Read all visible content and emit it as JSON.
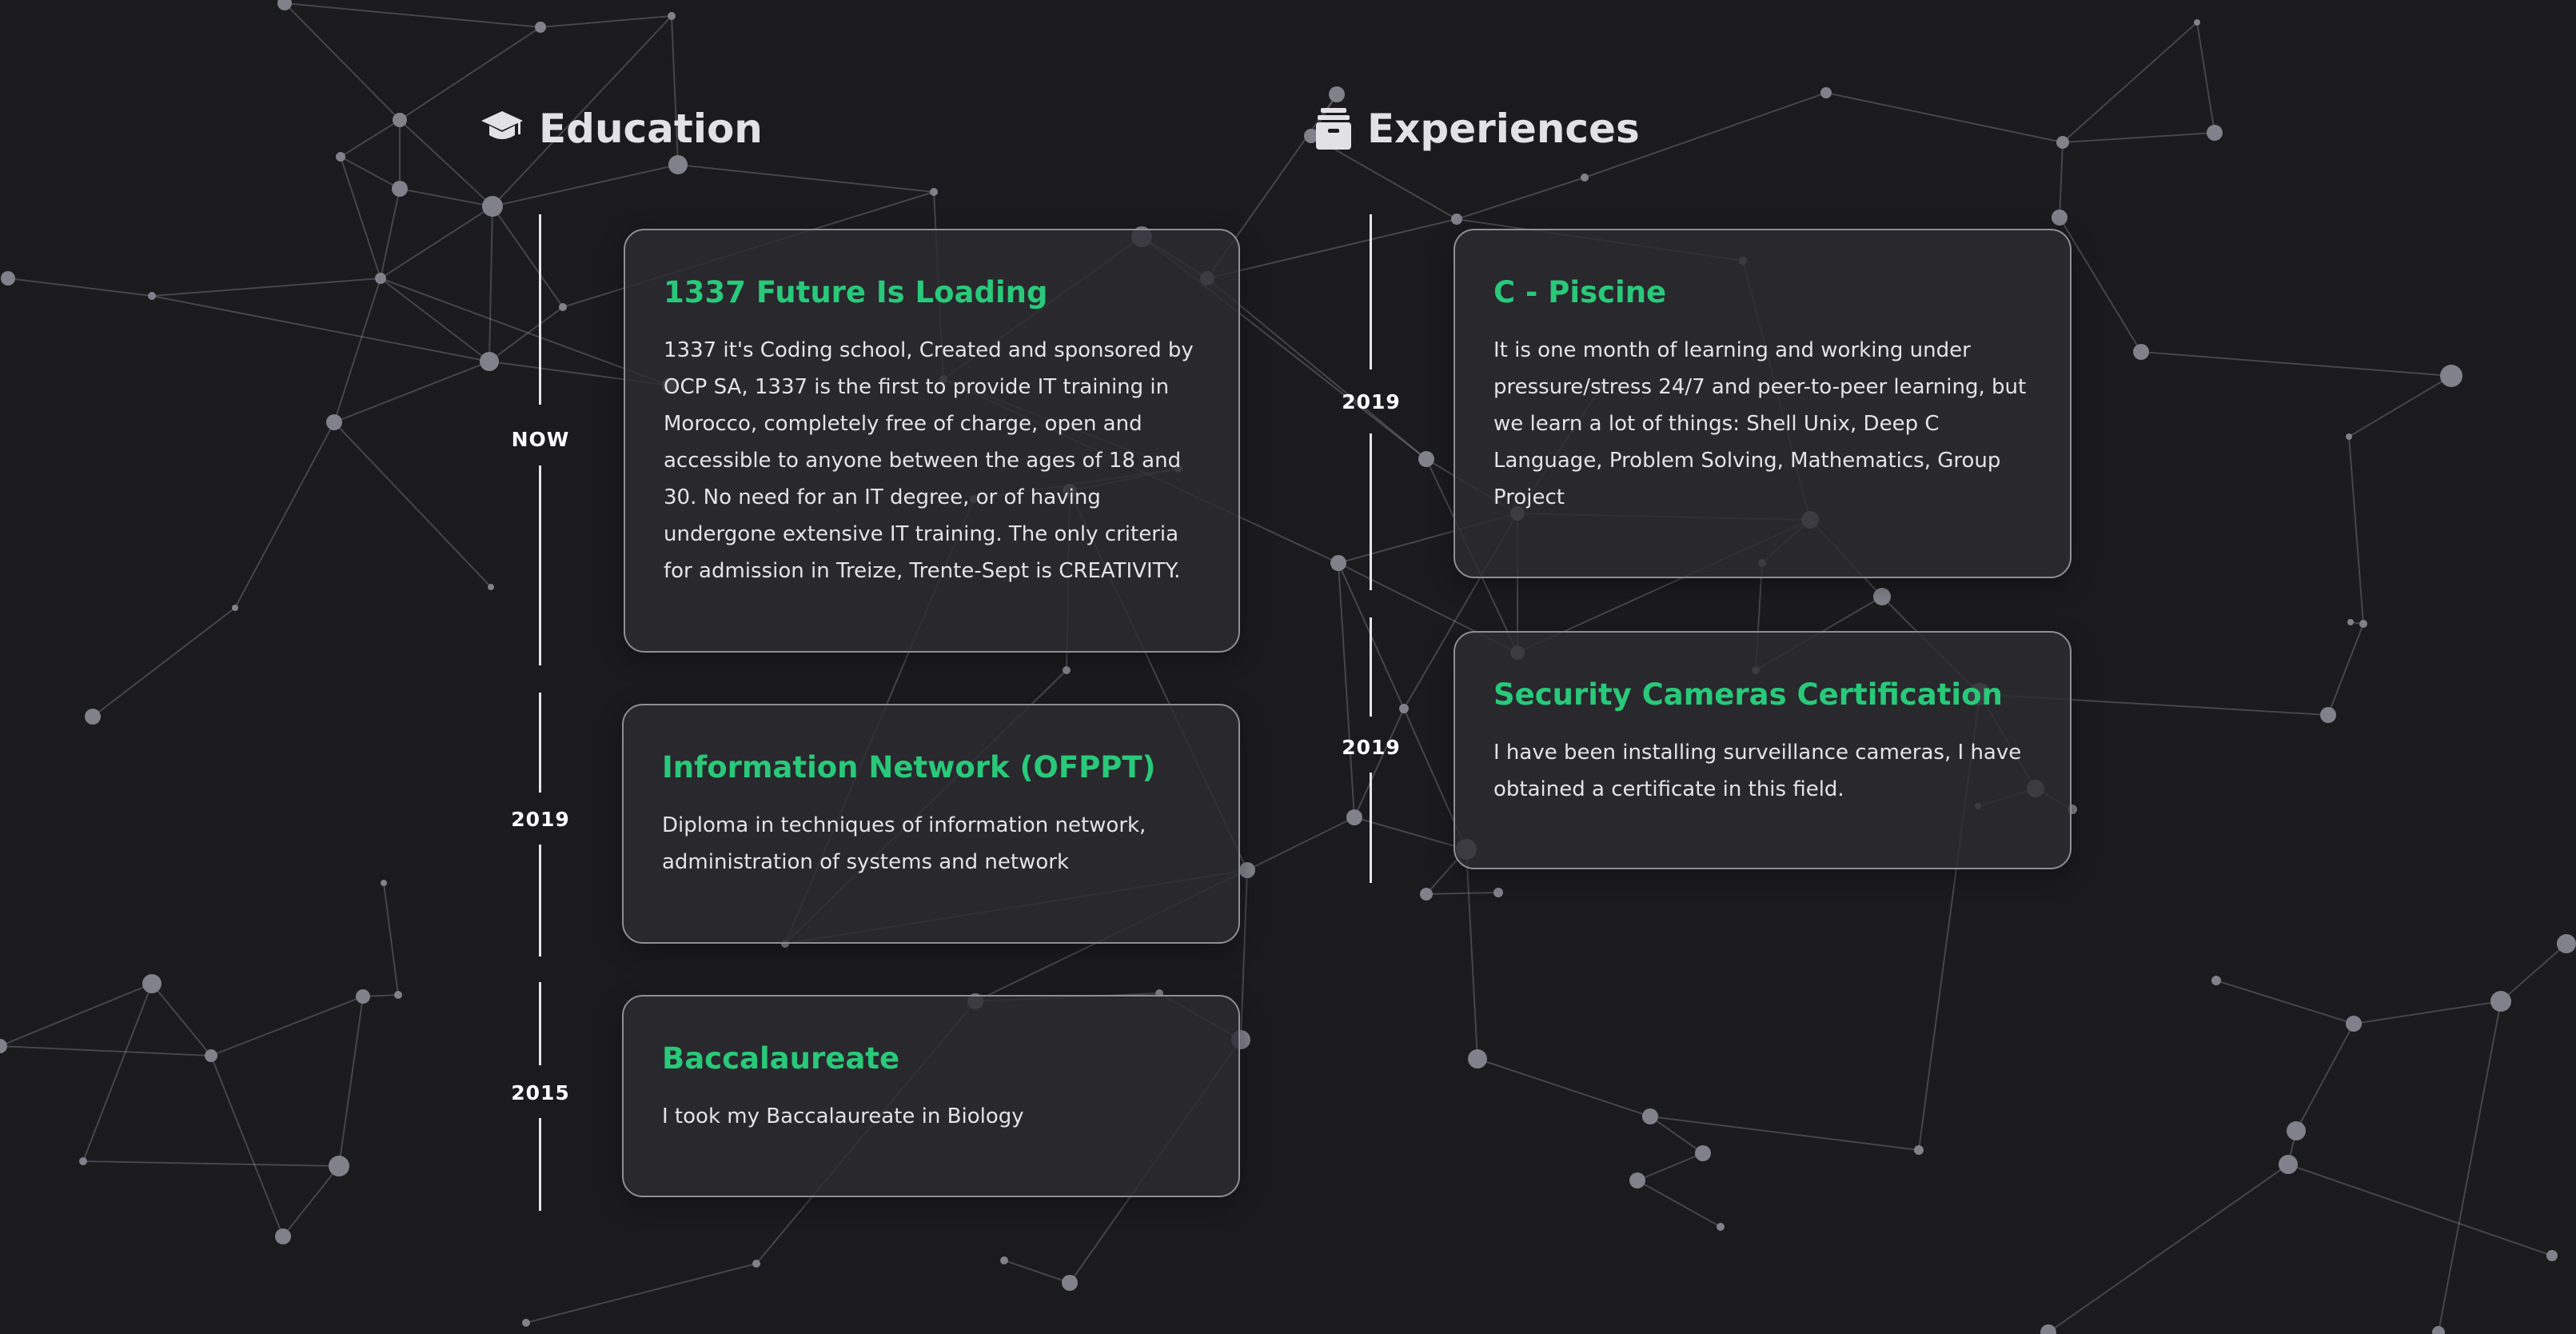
{
  "education": {
    "heading": "Education",
    "icon": "graduation-cap-icon",
    "items": [
      {
        "date": "NOW",
        "title": "1337 Future Is Loading",
        "description": "1337 it's Coding school, Created and sponsored by OCP SA, 1337 is the first to provide IT training in Morocco, completely free of charge, open and accessible to anyone between the ages of 18 and 30. No need for an IT degree, or of having undergone extensive IT training. The only criteria for admission in Treize, Trente-Sept is CREATIVITY."
      },
      {
        "date": "2019",
        "title": "Information Network (OFPPT)",
        "description": "Diploma in techniques of information network, administration of systems and network"
      },
      {
        "date": "2015",
        "title": "Baccalaureate",
        "description": "I took my Baccalaureate in Biology"
      }
    ]
  },
  "experiences": {
    "heading": "Experiences",
    "icon": "archive-box-icon",
    "items": [
      {
        "date": "2019",
        "title": "C - Piscine",
        "description": "It is one month of learning and working under pressure/stress 24/7 and peer-to-peer learning, but we learn a lot of things: Shell Unix, Deep C Language, Problem Solving, Mathematics, Group Project"
      },
      {
        "date": "2019",
        "title": "Security Cameras Certification",
        "description": "I have been installing surveillance cameras, I have obtained a certificate in this field."
      }
    ]
  },
  "colors": {
    "background": "#1b1b1e",
    "card_background": "#2c2c31",
    "card_border": "#8e8e94",
    "accent_green": "#29c97a",
    "text": "#e4e4e6",
    "network_node": "#80818a"
  }
}
